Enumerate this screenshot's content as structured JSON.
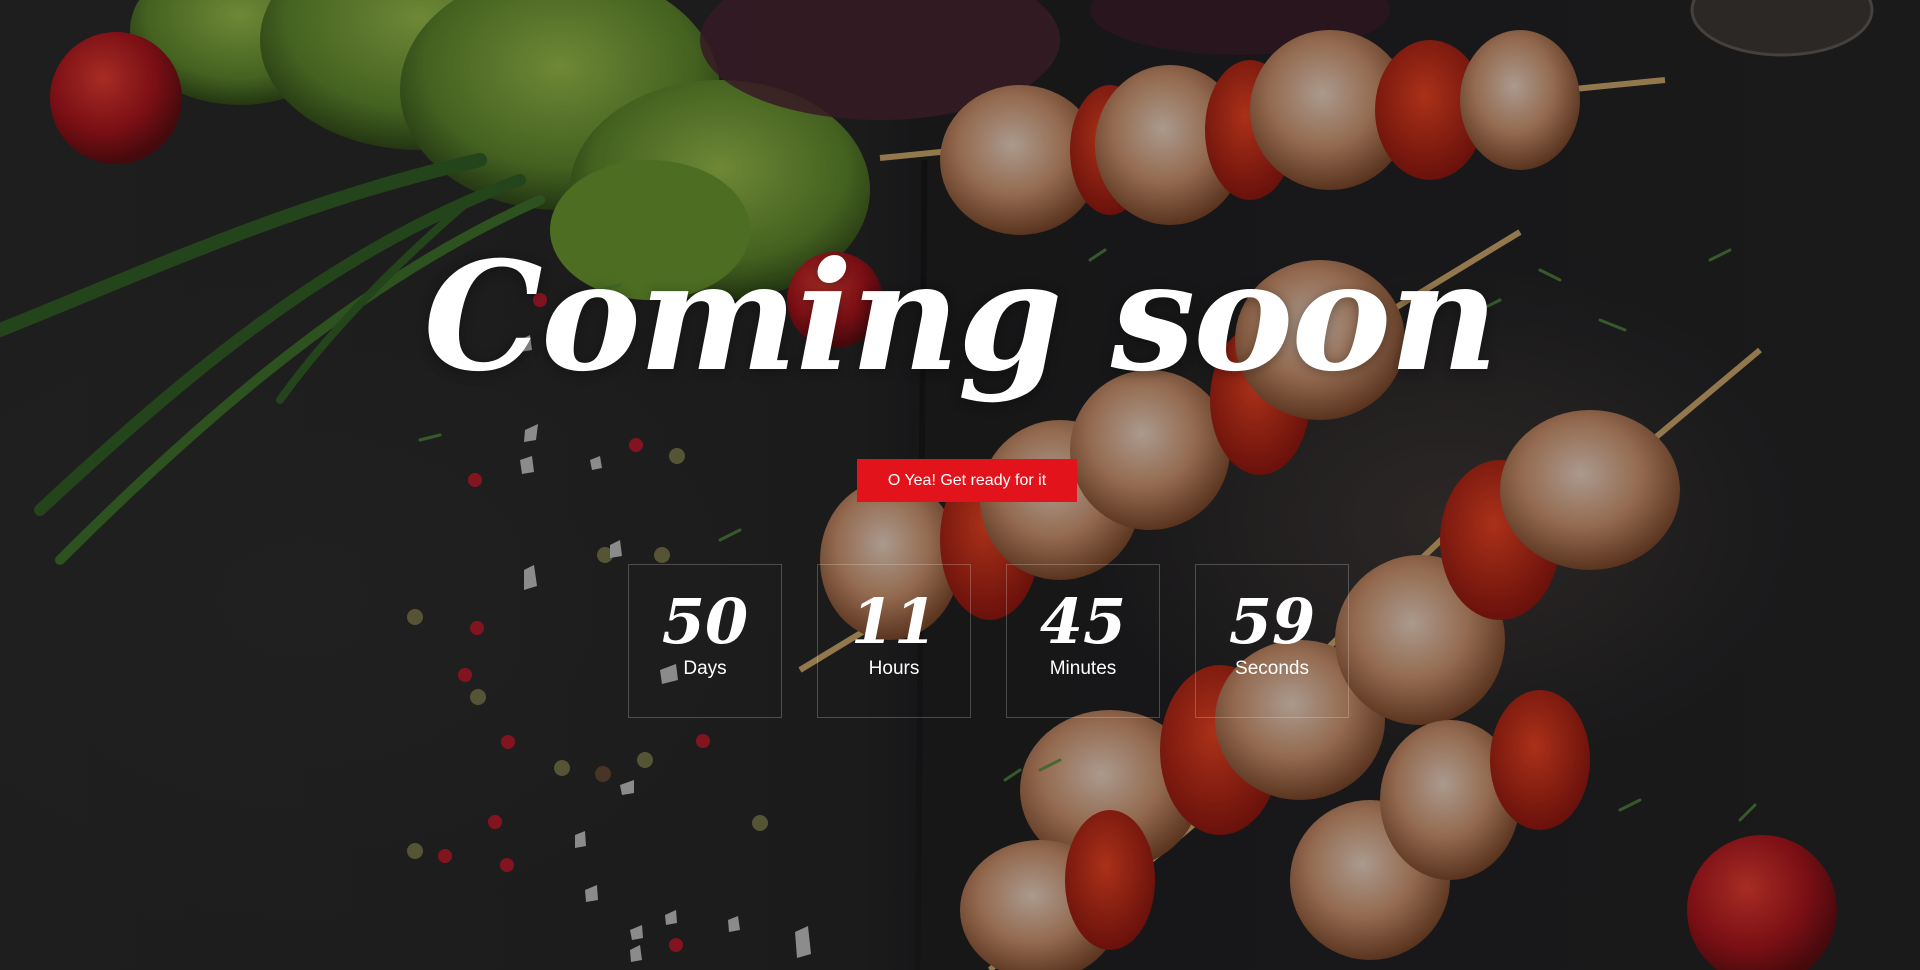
{
  "page": {
    "title": "Coming soon",
    "cta_label": "O Yea! Get ready for it"
  },
  "countdown": [
    {
      "value": "50",
      "label": "Days"
    },
    {
      "value": "11",
      "label": "Hours"
    },
    {
      "value": "45",
      "label": "Minutes"
    },
    {
      "value": "59",
      "label": "Seconds"
    }
  ],
  "colors": {
    "accent": "#e3131b",
    "text": "#ffffff",
    "background": "#1b1b1c"
  },
  "background": {
    "description_icon": "food-photo-skewers"
  }
}
